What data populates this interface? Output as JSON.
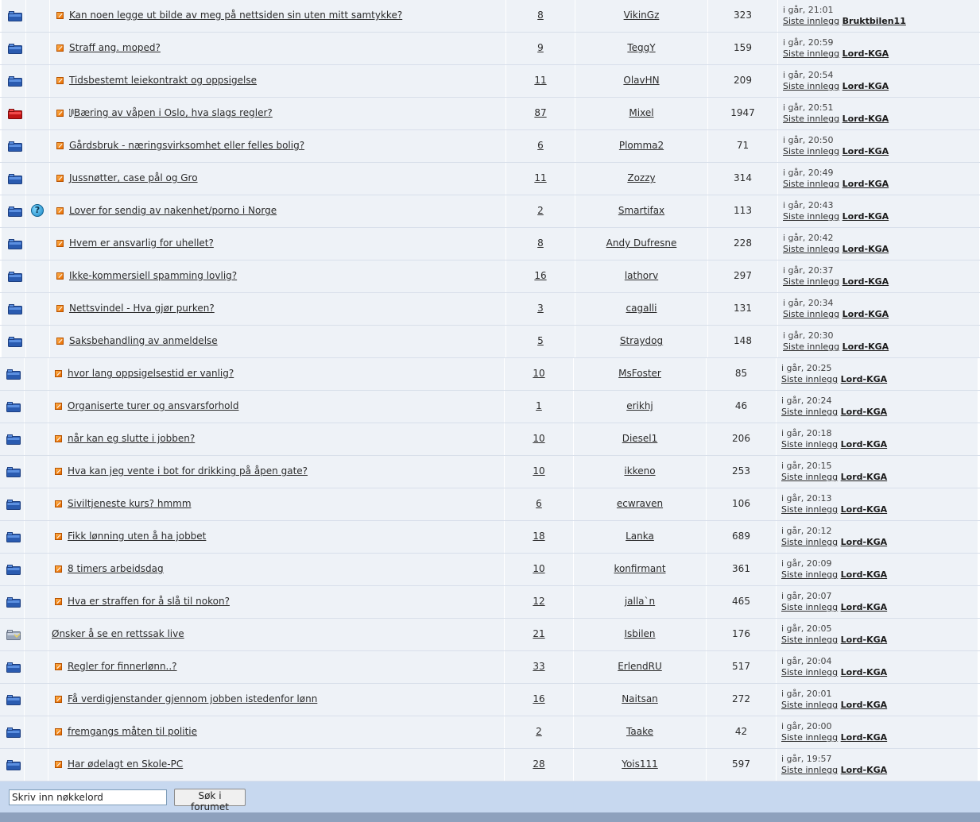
{
  "threads": [
    {
      "folder": "blue",
      "help": false,
      "newicon": true,
      "title": "Kan noen legge ut bilde av meg på nettsiden sin uten mitt samtykke?",
      "replies": "8",
      "author": "VikinGz",
      "views": "323",
      "time": "i går, 21:01",
      "last_link": "Siste innlegg",
      "last_user": "Bruktbilen11"
    },
    {
      "folder": "blue",
      "help": false,
      "newicon": true,
      "title": "Straff ang. moped?",
      "replies": "9",
      "author": "TeggY",
      "views": "159",
      "time": "i går, 20:59",
      "last_link": "Siste innlegg",
      "last_user": "Lord-KGA"
    },
    {
      "folder": "blue",
      "help": false,
      "newicon": true,
      "title": "Tidsbestemt leiekontrakt og oppsigelse",
      "replies": "11",
      "author": "OlavHN",
      "views": "209",
      "time": "i går, 20:54",
      "last_link": "Siste innlegg",
      "last_user": "Lord-KGA"
    },
    {
      "folder": "red",
      "help": false,
      "newicon": true,
      "locked": true,
      "title": "Bæring av våpen i Oslo, hva slags regler?",
      "replies": "87",
      "author": "Mixel",
      "views": "1947",
      "time": "i går, 20:51",
      "last_link": "Siste innlegg",
      "last_user": "Lord-KGA"
    },
    {
      "folder": "blue",
      "help": false,
      "newicon": true,
      "title": "Gårdsbruk - næringsvirksomhet eller felles bolig?",
      "replies": "6",
      "author": "Plomma2",
      "views": "71",
      "time": "i går, 20:50",
      "last_link": "Siste innlegg",
      "last_user": "Lord-KGA"
    },
    {
      "folder": "blue",
      "help": false,
      "newicon": true,
      "title": "Jussnøtter, case pål og Gro",
      "replies": "11",
      "author": "Zozzy",
      "views": "314",
      "time": "i går, 20:49",
      "last_link": "Siste innlegg",
      "last_user": "Lord-KGA"
    },
    {
      "folder": "blue",
      "help": true,
      "newicon": true,
      "title": "Lover for sendig av nakenhet/porno i Norge",
      "replies": "2",
      "author": "Smartifax",
      "views": "113",
      "time": "i går, 20:43",
      "last_link": "Siste innlegg",
      "last_user": "Lord-KGA"
    },
    {
      "folder": "blue",
      "help": false,
      "newicon": true,
      "title": "Hvem er ansvarlig for uhellet?",
      "replies": "8",
      "author": "Andy Dufresne",
      "views": "228",
      "time": "i går, 20:42",
      "last_link": "Siste innlegg",
      "last_user": "Lord-KGA"
    },
    {
      "folder": "blue",
      "help": false,
      "newicon": true,
      "title": "Ikke-kommersiell spamming lovlig?",
      "replies": "16",
      "author": "lathorv",
      "views": "297",
      "time": "i går, 20:37",
      "last_link": "Siste innlegg",
      "last_user": "Lord-KGA"
    },
    {
      "folder": "blue",
      "help": false,
      "newicon": true,
      "title": "Nettsvindel - Hva gjør purken?",
      "replies": "3",
      "author": "cagalli",
      "views": "131",
      "time": "i går, 20:34",
      "last_link": "Siste innlegg",
      "last_user": "Lord-KGA"
    },
    {
      "folder": "blue",
      "help": false,
      "newicon": true,
      "title": "Saksbehandling av anmeldelse",
      "replies": "5",
      "author": "Straydog",
      "views": "148",
      "time": "i går, 20:30",
      "last_link": "Siste innlegg",
      "last_user": "Lord-KGA"
    },
    {
      "folder": "blue",
      "help": false,
      "newicon": true,
      "title": "hvor lang oppsigelsestid er vanlig?",
      "replies": "10",
      "author": "MsFoster",
      "views": "85",
      "time": "i går, 20:25",
      "last_link": "Siste innlegg",
      "last_user": "Lord-KGA"
    },
    {
      "folder": "blue",
      "help": false,
      "newicon": true,
      "title": "Organiserte turer og ansvarsforhold",
      "replies": "1",
      "author": "erikhj",
      "views": "46",
      "time": "i går, 20:24",
      "last_link": "Siste innlegg",
      "last_user": "Lord-KGA"
    },
    {
      "folder": "blue",
      "help": false,
      "newicon": true,
      "title": "når kan eg slutte i jobben?",
      "replies": "10",
      "author": "Diesel1",
      "views": "206",
      "time": "i går, 20:18",
      "last_link": "Siste innlegg",
      "last_user": "Lord-KGA"
    },
    {
      "folder": "blue",
      "help": false,
      "newicon": true,
      "title": "Hva kan jeg vente i bot for drikking på åpen gate?",
      "replies": "10",
      "author": "ikkeno",
      "views": "253",
      "time": "i går, 20:15",
      "last_link": "Siste innlegg",
      "last_user": "Lord-KGA"
    },
    {
      "folder": "blue",
      "help": false,
      "newicon": true,
      "title": "Siviltjeneste kurs? hmmm",
      "replies": "6",
      "author": "ecwraven",
      "views": "106",
      "time": "i går, 20:13",
      "last_link": "Siste innlegg",
      "last_user": "Lord-KGA"
    },
    {
      "folder": "blue",
      "help": false,
      "newicon": true,
      "title": "Fikk lønning uten å ha jobbet",
      "replies": "18",
      "author": "Lanka",
      "views": "689",
      "time": "i går, 20:12",
      "last_link": "Siste innlegg",
      "last_user": "Lord-KGA"
    },
    {
      "folder": "blue",
      "help": false,
      "newicon": true,
      "title": "8 timers arbeidsdag",
      "replies": "10",
      "author": "konfirmant",
      "views": "361",
      "time": "i går, 20:09",
      "last_link": "Siste innlegg",
      "last_user": "Lord-KGA"
    },
    {
      "folder": "blue",
      "help": false,
      "newicon": true,
      "title": "Hva er straffen for å slå til nokon?",
      "replies": "12",
      "author": "jalla`n",
      "views": "465",
      "time": "i går, 20:07",
      "last_link": "Siste innlegg",
      "last_user": "Lord-KGA"
    },
    {
      "folder": "grey",
      "help": false,
      "newicon": false,
      "title": "Ønsker å se en rettssak live",
      "replies": "21",
      "author": "Isbilen",
      "views": "176",
      "time": "i går, 20:05",
      "last_link": "Siste innlegg",
      "last_user": "Lord-KGA"
    },
    {
      "folder": "blue",
      "help": false,
      "newicon": true,
      "title": "Regler for finnerlønn..?",
      "replies": "33",
      "author": "ErlendRU",
      "views": "517",
      "time": "i går, 20:04",
      "last_link": "Siste innlegg",
      "last_user": "Lord-KGA"
    },
    {
      "folder": "blue",
      "help": false,
      "newicon": true,
      "title": "Få verdigjenstander gjennom jobben istedenfor lønn",
      "replies": "16",
      "author": "Naitsan",
      "views": "272",
      "time": "i går, 20:01",
      "last_link": "Siste innlegg",
      "last_user": "Lord-KGA"
    },
    {
      "folder": "blue",
      "help": false,
      "newicon": true,
      "title": "fremgangs måten til politie",
      "replies": "2",
      "author": "Taake",
      "views": "42",
      "time": "i går, 20:00",
      "last_link": "Siste innlegg",
      "last_user": "Lord-KGA"
    },
    {
      "folder": "blue",
      "help": false,
      "newicon": true,
      "title": "Har ødelagt en Skole-PC",
      "replies": "28",
      "author": "Yois111",
      "views": "597",
      "time": "i går, 19:57",
      "last_link": "Siste innlegg",
      "last_user": "Lord-KGA"
    }
  ],
  "search": {
    "placeholder": "Skriv inn nøkkelord",
    "button": "Søk i forumet"
  },
  "colors": {
    "cell_bg": "#eef2f7",
    "footer_bg": "#c7d8ef",
    "bottom_bar": "#8ea1bd",
    "folder_blue": "#3d6fc4",
    "folder_red": "#d41c1c"
  }
}
